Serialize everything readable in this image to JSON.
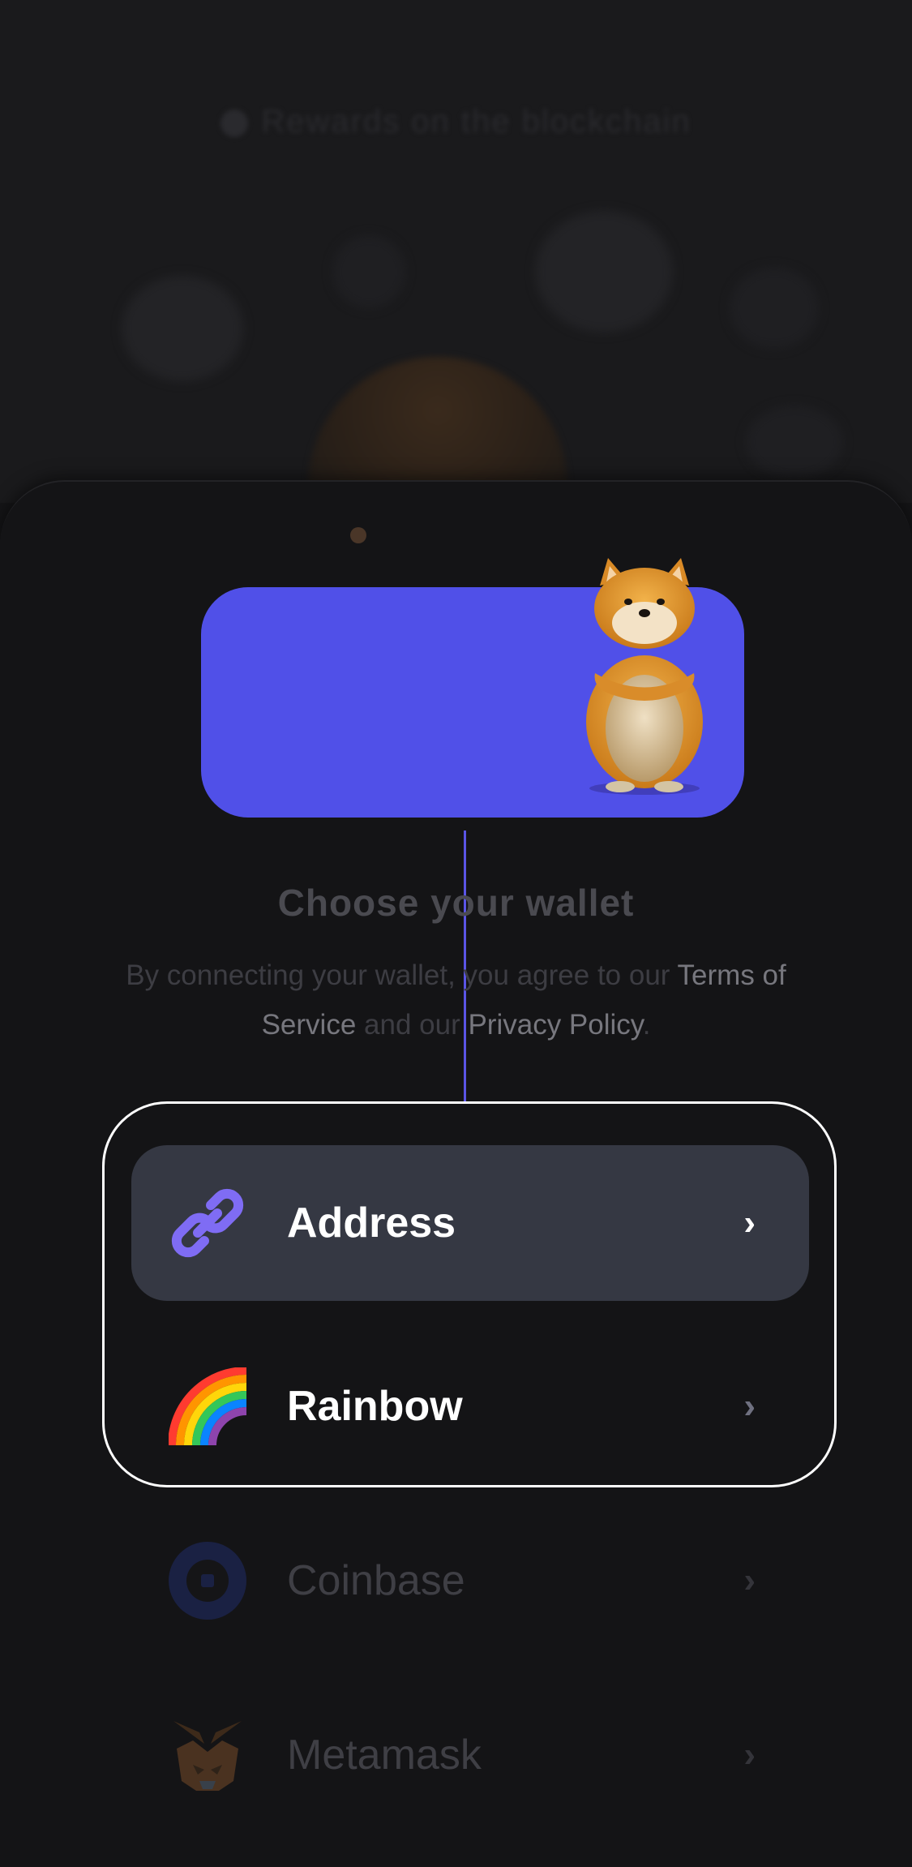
{
  "background": {
    "title": "Rewards on the blockchain"
  },
  "sheet": {
    "title": "Choose your wallet",
    "terms_prefix": "By connecting your wallet, you agree to our ",
    "terms_link": "Terms of Service",
    "terms_middle": " and our ",
    "privacy_link": "Privacy Policy",
    "terms_suffix": "."
  },
  "wallets": [
    {
      "label": "Address",
      "icon": "link-icon",
      "state": "active"
    },
    {
      "label": "Rainbow",
      "icon": "rainbow-icon",
      "state": "highlighted"
    },
    {
      "label": "Coinbase",
      "icon": "coinbase-icon",
      "state": "dimmed"
    },
    {
      "label": "Metamask",
      "icon": "metamask-fox-icon",
      "state": "dimmed"
    }
  ],
  "colors": {
    "accent": "#5050e8",
    "row_active_bg": "#353843",
    "background": "#151517"
  }
}
